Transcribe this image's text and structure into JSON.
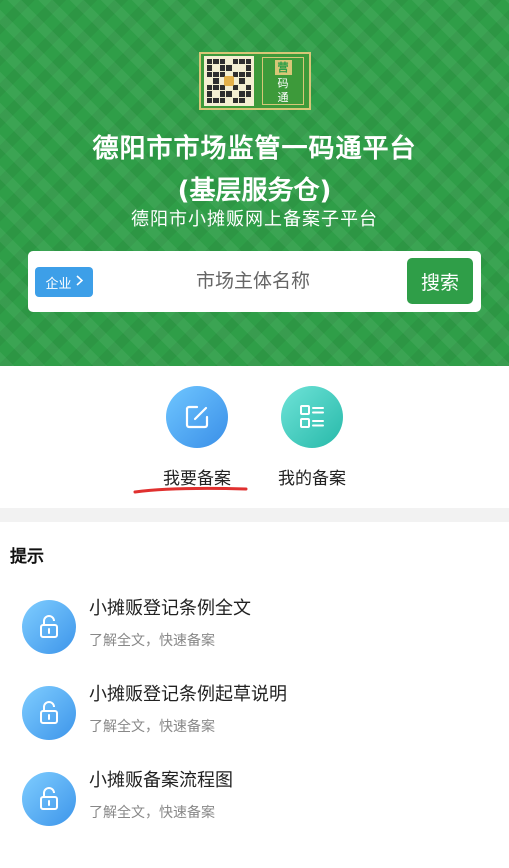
{
  "header": {
    "logo_text": [
      "营",
      "码",
      "通"
    ],
    "title_line1": "德阳市市场监管一码通平台",
    "title_line2": "(基层服务仓)",
    "subtitle": "德阳市小摊贩网上备案子平台"
  },
  "search": {
    "type_label": "企业",
    "placeholder": "市场主体名称",
    "button_label": "搜索"
  },
  "shortcuts": [
    {
      "label": "我要备案",
      "icon": "edit-icon"
    },
    {
      "label": "我的备案",
      "icon": "list-icon"
    }
  ],
  "tips": {
    "title": "提示",
    "items": [
      {
        "title": "小摊贩登记条例全文",
        "desc": "了解全文，快速备案",
        "icon": "lock-icon"
      },
      {
        "title": "小摊贩登记条例起草说明",
        "desc": "了解全文，快速备案",
        "icon": "lock-icon"
      },
      {
        "title": "小摊贩备案流程图",
        "desc": "了解全文，快速备案",
        "icon": "lock-icon"
      }
    ]
  },
  "colors": {
    "brand_green": "#2f9e48",
    "accent_blue": "#3d9fe8",
    "teal": "#27b9a9",
    "underline_red": "#e0302f"
  }
}
